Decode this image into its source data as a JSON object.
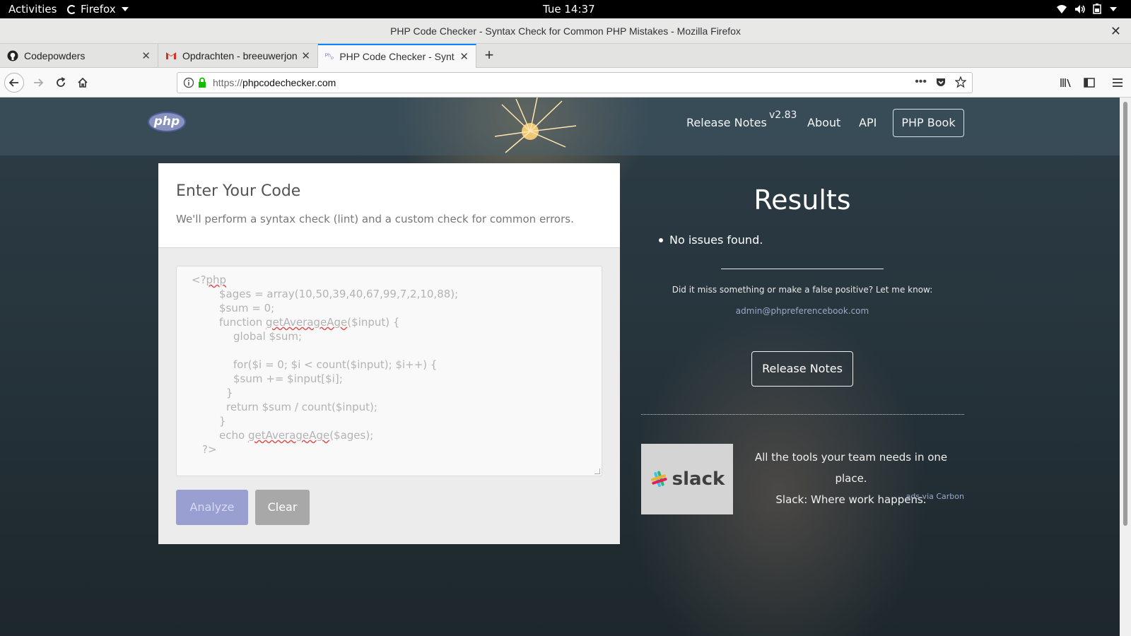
{
  "os_topbar": {
    "activities": "Activities",
    "app_name": "Firefox",
    "clock": "Tue 14:37"
  },
  "window": {
    "title": "PHP Code Checker - Syntax Check for Common PHP Mistakes - Mozilla Firefox"
  },
  "tabs": [
    {
      "title": "Codepowders",
      "icon": "github-icon"
    },
    {
      "title": "Opdrachten - breeuwerjon",
      "icon": "gmail-icon"
    },
    {
      "title": "PHP Code Checker - Synt",
      "icon": "php-favicon",
      "active": true
    }
  ],
  "address_bar": {
    "protocol": "https://",
    "host": "phpcodechecker.com"
  },
  "site_nav": {
    "release_notes": "Release Notes",
    "version": "v2.83",
    "about": "About",
    "api": "API",
    "php_book": "PHP Book"
  },
  "code_panel": {
    "title": "Enter Your Code",
    "subtitle": "We'll perform a syntax check (lint) and a custom check for common errors.",
    "code_lines": [
      "<?php",
      "$ages = array(10,50,39,40,67,99,7,2,10,88);",
      "$sum = 0;",
      "function getAverageAge($input) {",
      "global $sum;",
      "",
      "for($i = 0; $i < count($input); $i++) {",
      "$sum += $input[$i];",
      "}",
      "return $sum / count($input);",
      "}",
      "echo getAverageAge($ages);",
      "?>"
    ],
    "analyze_label": "Analyze",
    "clear_label": "Clear"
  },
  "results": {
    "title": "Results",
    "items": [
      "No issues found."
    ],
    "feedback_text": "Did it miss something or make a false positive? Let me know:",
    "email": "admin@phpreferencebook.com",
    "release_notes_button": "Release Notes"
  },
  "ad": {
    "brand": "slack",
    "line1": "All the tools your team needs in one place.",
    "line2": "Slack: Where work happens.",
    "via": "ads via Carbon"
  },
  "colors": {
    "accent_tab": "#0a84ff",
    "analyze_button": "#9a9fd1",
    "clear_button": "#a8a8a8",
    "php_logo": "#8892bf"
  }
}
